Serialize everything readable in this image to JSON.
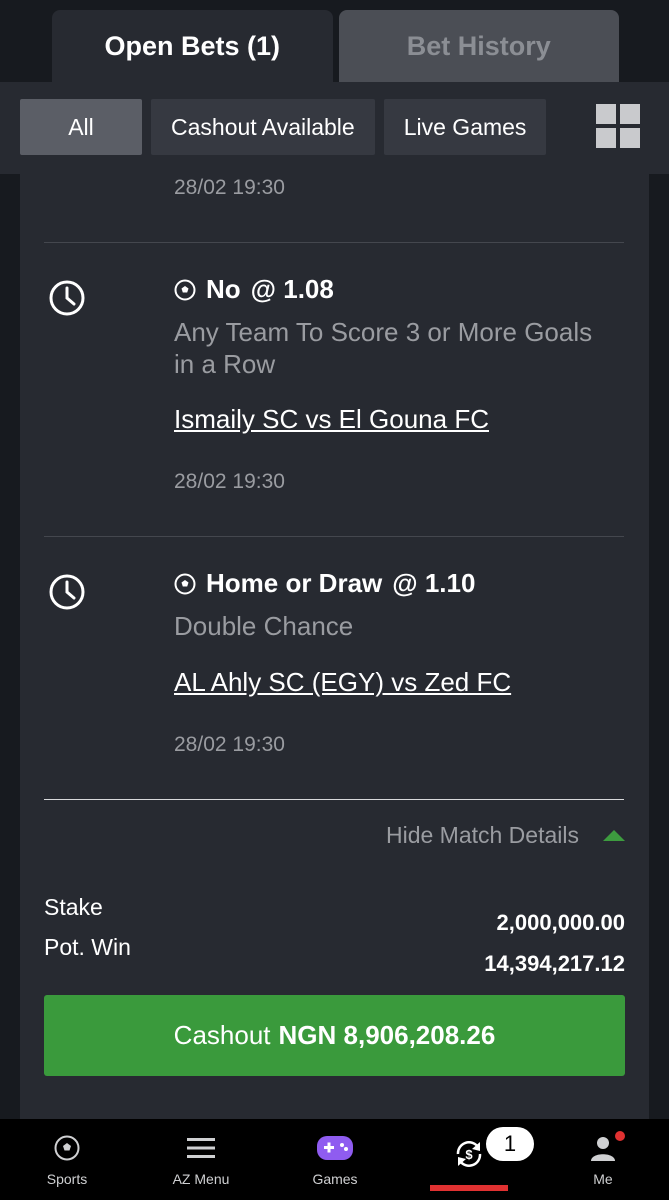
{
  "tabs": {
    "open_bets": "Open Bets (1)",
    "bet_history": "Bet History"
  },
  "filters": {
    "all": "All",
    "cashout_available": "Cashout Available",
    "live_games": "Live Games"
  },
  "bets": [
    {
      "date": "28/02 19:30"
    },
    {
      "selection": "No",
      "odds": "@ 1.08",
      "market": "Any Team To Score 3 or More Goals in a Row",
      "match": "Ismaily SC vs El Gouna FC",
      "date": "28/02 19:30",
      "status_icon": "clock-icon"
    },
    {
      "selection": "Home or Draw",
      "odds": "@ 1.10",
      "market": "Double Chance",
      "match": "AL Ahly SC (EGY) vs Zed FC",
      "date": "28/02 19:30",
      "status_icon": "clock-icon"
    }
  ],
  "details": {
    "hide_label": "Hide Match Details"
  },
  "summary": {
    "stake_label": "Stake",
    "stake_value": "2,000,000.00",
    "potwin_label": "Pot. Win",
    "potwin_value": "14,394,217.12"
  },
  "cashout": {
    "label": "Cashout",
    "amount": "NGN 8,906,208.26"
  },
  "nav": {
    "sports": "Sports",
    "az_menu": "AZ Menu",
    "games": "Games",
    "open_bets_count": "1",
    "me": "Me"
  },
  "colors": {
    "accent_green": "#3a9a3c",
    "active_red": "#e03131",
    "card_bg": "#272a31"
  }
}
